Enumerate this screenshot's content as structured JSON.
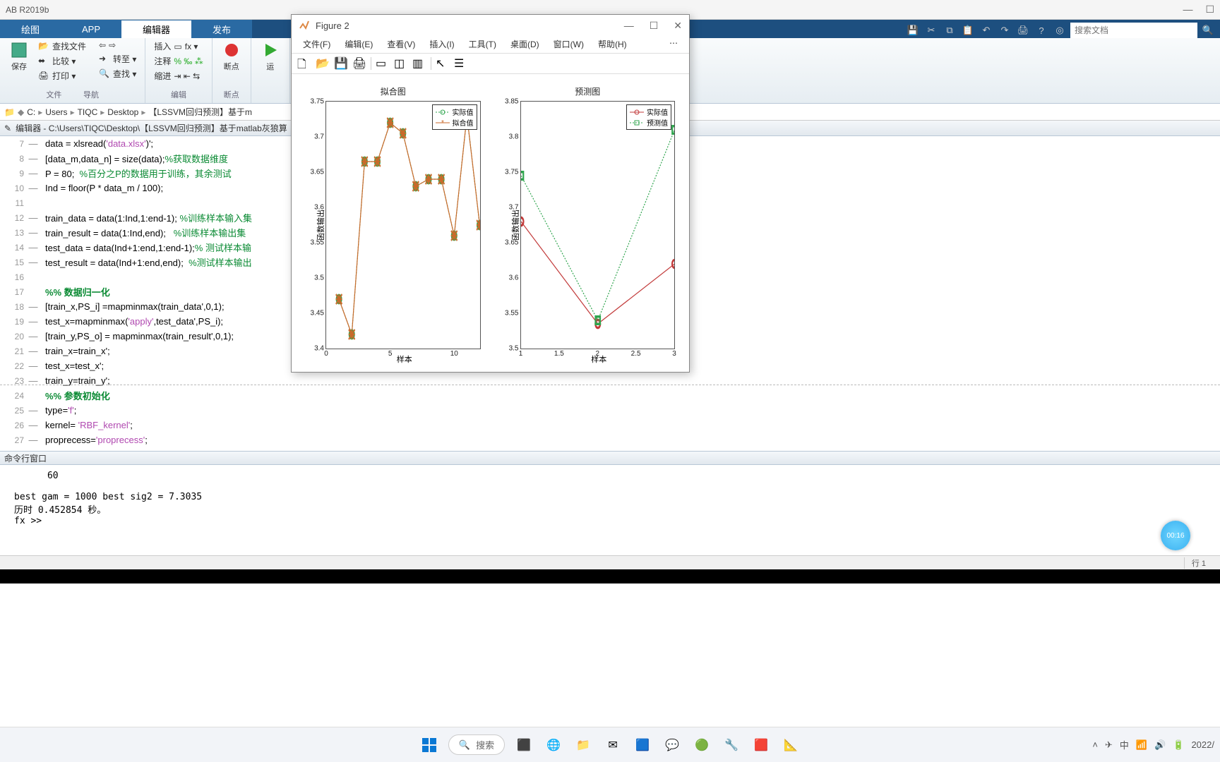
{
  "app_title": "AB R2019b",
  "tabs": {
    "plot": "绘图",
    "app": "APP",
    "editor": "编辑器",
    "publish": "发布"
  },
  "toolstrip": {
    "save": "保存",
    "findfiles": "查找文件",
    "compare": "比较 ▾",
    "print": "打印 ▾",
    "nav": "导航",
    "goto": "转至 ▾",
    "find": "查找 ▾",
    "files_lbl": "文件",
    "insert": "插入",
    "comment": "注释",
    "indent": "缩进",
    "edit_lbl": "编辑",
    "breakpoint": "断点",
    "bp_lbl": "断点",
    "run": "运"
  },
  "search_placeholder": "搜索文档",
  "breadcrumb": [
    "C:",
    "Users",
    "TIQC",
    "Desktop",
    "【LSSVM回归预测】基于m"
  ],
  "editor_header": "编辑器 - C:\\Users\\TIQC\\Desktop\\【LSSVM回归预测】基于matlab灰狼算",
  "code": [
    {
      "n": 7,
      "d": true,
      "raw": "data = xlsread(",
      "str": "'data.xlsx'",
      "tail": ")';"
    },
    {
      "n": 8,
      "d": true,
      "raw": "[data_m,data_n] = size(data);",
      "com": "%获取数据维度"
    },
    {
      "n": 9,
      "d": true,
      "raw": "P = 80;  ",
      "com": "%百分之P的数据用于训练，其余测试"
    },
    {
      "n": 10,
      "d": true,
      "raw": "Ind = floor(P * data_m / 100);"
    },
    {
      "n": 11,
      "d": false,
      "raw": ""
    },
    {
      "n": 12,
      "d": true,
      "raw": "train_data = data(1:Ind,1:end-1); ",
      "com": "%训练样本输入集"
    },
    {
      "n": 13,
      "d": true,
      "raw": "train_result = data(1:Ind,end);   ",
      "com": "%训练样本输出集"
    },
    {
      "n": 14,
      "d": true,
      "raw": "test_data = data(Ind+1:end,1:end-1);",
      "com": "% 测试样本输"
    },
    {
      "n": 15,
      "d": true,
      "raw": "test_result = data(Ind+1:end,end);  ",
      "com": "%测试样本输出"
    },
    {
      "n": 16,
      "d": false,
      "raw": ""
    },
    {
      "n": 17,
      "d": false,
      "sec": "%% 数据归一化"
    },
    {
      "n": 18,
      "d": true,
      "raw": "[train_x,PS_i] =mapminmax(train_data',0,1);"
    },
    {
      "n": 19,
      "d": true,
      "raw": "test_x=mapminmax(",
      "str": "'apply'",
      "tail": ",test_data',PS_i);"
    },
    {
      "n": 20,
      "d": true,
      "raw": "[train_y,PS_o] = mapminmax(train_result',0,1);"
    },
    {
      "n": 21,
      "d": true,
      "raw": "train_x=train_x';"
    },
    {
      "n": 22,
      "d": true,
      "raw": "test_x=test_x';"
    },
    {
      "n": 23,
      "d": true,
      "raw": "train_y=train_y';"
    },
    {
      "n": 24,
      "d": false,
      "sec": "%% 参数初始化"
    },
    {
      "n": 25,
      "d": true,
      "raw": "type=",
      "str": "'f'",
      "tail": ";"
    },
    {
      "n": 26,
      "d": true,
      "raw": "kernel= ",
      "str": "'RBF_kernel'",
      "tail": ";"
    },
    {
      "n": 27,
      "d": true,
      "raw": "proprecess=",
      "str": "'proprecess'",
      "tail": ";"
    }
  ],
  "cmdwin_hdr": "命令行窗口",
  "cmdwin": "      60\n\nbest gam = 1000 best sig2 = 7.3035\n历时 0.452854 秒。\nfx >>",
  "status": {
    "row": "行",
    "rowval": "1"
  },
  "fig": {
    "title": "Figure 2",
    "menu": [
      "文件(F)",
      "编辑(E)",
      "查看(V)",
      "插入(I)",
      "工具(T)",
      "桌面(D)",
      "窗口(W)",
      "帮助(H)"
    ]
  },
  "chart_data": [
    {
      "type": "line",
      "title": "拟合图",
      "xlabel": "样本",
      "ylabel": "函数输出",
      "x": [
        1,
        2,
        3,
        4,
        5,
        6,
        7,
        8,
        9,
        10,
        11,
        12
      ],
      "series": [
        {
          "name": "实际值",
          "color": "#2fa54e",
          "marker": "o",
          "dash": true,
          "values": [
            3.47,
            3.42,
            3.665,
            3.665,
            3.72,
            3.705,
            3.63,
            3.64,
            3.64,
            3.56,
            3.73,
            3.575
          ]
        },
        {
          "name": "拟合值",
          "color": "#c96a2b",
          "marker": "*",
          "dash": false,
          "values": [
            3.47,
            3.42,
            3.665,
            3.665,
            3.72,
            3.705,
            3.63,
            3.64,
            3.64,
            3.56,
            3.73,
            3.575
          ]
        }
      ],
      "xlim": [
        0,
        12
      ],
      "ylim": [
        3.4,
        3.75
      ],
      "yticks": [
        3.4,
        3.45,
        3.5,
        3.55,
        3.6,
        3.65,
        3.7,
        3.75
      ],
      "xticks": [
        0,
        5,
        10
      ]
    },
    {
      "type": "line",
      "title": "预测图",
      "xlabel": "样本",
      "ylabel": "函数输出",
      "x": [
        1,
        2,
        3
      ],
      "series": [
        {
          "name": "实际值",
          "color": "#c23a3a",
          "marker": "o",
          "dash": false,
          "values": [
            3.68,
            3.535,
            3.62
          ]
        },
        {
          "name": "预测值",
          "color": "#2fa54e",
          "marker": "s",
          "dash": true,
          "values": [
            3.745,
            3.54,
            3.81
          ]
        }
      ],
      "xlim": [
        1,
        3
      ],
      "ylim": [
        3.5,
        3.85
      ],
      "yticks": [
        3.5,
        3.55,
        3.6,
        3.65,
        3.7,
        3.75,
        3.8,
        3.85
      ],
      "xticks": [
        1,
        1.5,
        2,
        2.5,
        3
      ]
    }
  ],
  "taskbar_search": "搜索",
  "timer": "00:16",
  "clock": "2022/"
}
